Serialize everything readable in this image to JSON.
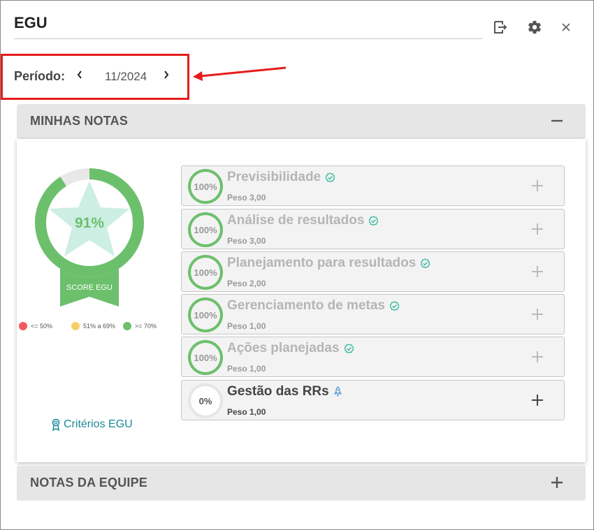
{
  "header": {
    "title": "EGU"
  },
  "period": {
    "label": "Período:",
    "value": "11/2024"
  },
  "minhas_notas": {
    "title": "MINHAS NOTAS",
    "score": {
      "value": 91,
      "label": "91%",
      "ribbon_label": "SCORE EGU",
      "color": "#6cc06c"
    },
    "legend": [
      {
        "label": "<= 50%",
        "color": "#f25c5c"
      },
      {
        "label": "51% a 69%",
        "color": "#f7cf6a"
      },
      {
        "label": ">= 70%",
        "color": "#6cc06c"
      }
    ],
    "criterios_label": "Critérios EGU",
    "items": [
      {
        "name": "Previsibilidade",
        "peso": "Peso 3,00",
        "percent": "100%",
        "progress": 1.0,
        "status": "done"
      },
      {
        "name": "Análise de resultados",
        "peso": "Peso 3,00",
        "percent": "100%",
        "progress": 1.0,
        "status": "done"
      },
      {
        "name": "Planejamento para resultados",
        "peso": "Peso 2,00",
        "percent": "100%",
        "progress": 1.0,
        "status": "done"
      },
      {
        "name": "Gerenciamento de metas",
        "peso": "Peso 1,00",
        "percent": "100%",
        "progress": 1.0,
        "status": "done"
      },
      {
        "name": "Ações planejadas",
        "peso": "Peso 1,00",
        "percent": "100%",
        "progress": 1.0,
        "status": "done"
      },
      {
        "name": "Gestão das RRs",
        "peso": "Peso 1,00",
        "percent": "0%",
        "progress": 0.0,
        "status": "in-progress"
      }
    ]
  },
  "notas_equipe": {
    "title": "NOTAS DA EQUIPE"
  },
  "colors": {
    "green": "#6cc06c",
    "check": "#2fb89a",
    "accent_link": "#1a8a9a",
    "highlight": "#e51c1c"
  }
}
